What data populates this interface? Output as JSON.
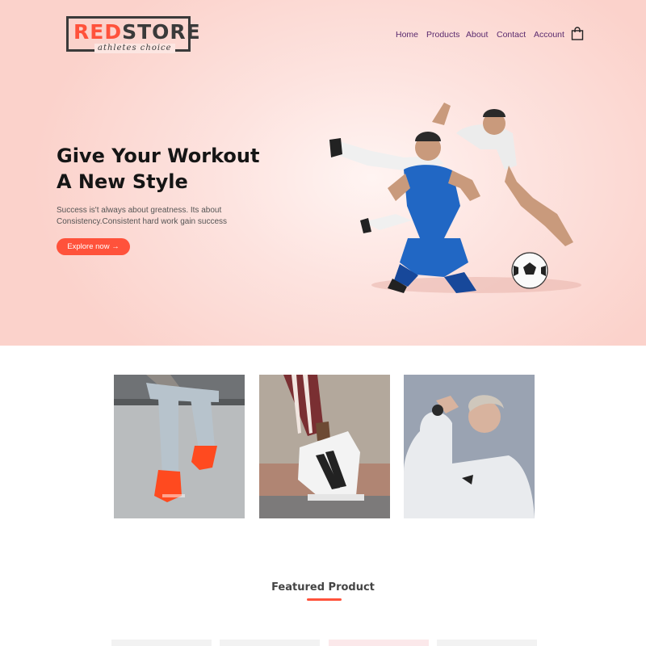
{
  "brand": {
    "name_red": "RED",
    "name_rest": "STORE",
    "tagline": "athletes choice",
    "accent_color": "#ff523b"
  },
  "nav": {
    "items": [
      {
        "label": "Home"
      },
      {
        "label": "Products"
      },
      {
        "label": "About"
      },
      {
        "label": "Contact"
      },
      {
        "label": "Account"
      }
    ],
    "cart_icon": "shopping-bag-icon"
  },
  "hero": {
    "title_line1": "Give Your Workout",
    "title_line2": "A New Style",
    "subtitle": "Success is't always about greatness. Its about Consistency.Consistent hard work gain success",
    "cta_label": "Explore now →"
  },
  "categories": [
    {
      "image": "sneakers-jeans-photo"
    },
    {
      "image": "striped-sneaker-photo"
    },
    {
      "image": "white-hoodie-photo"
    }
  ],
  "featured": {
    "title": "Featured Product"
  }
}
